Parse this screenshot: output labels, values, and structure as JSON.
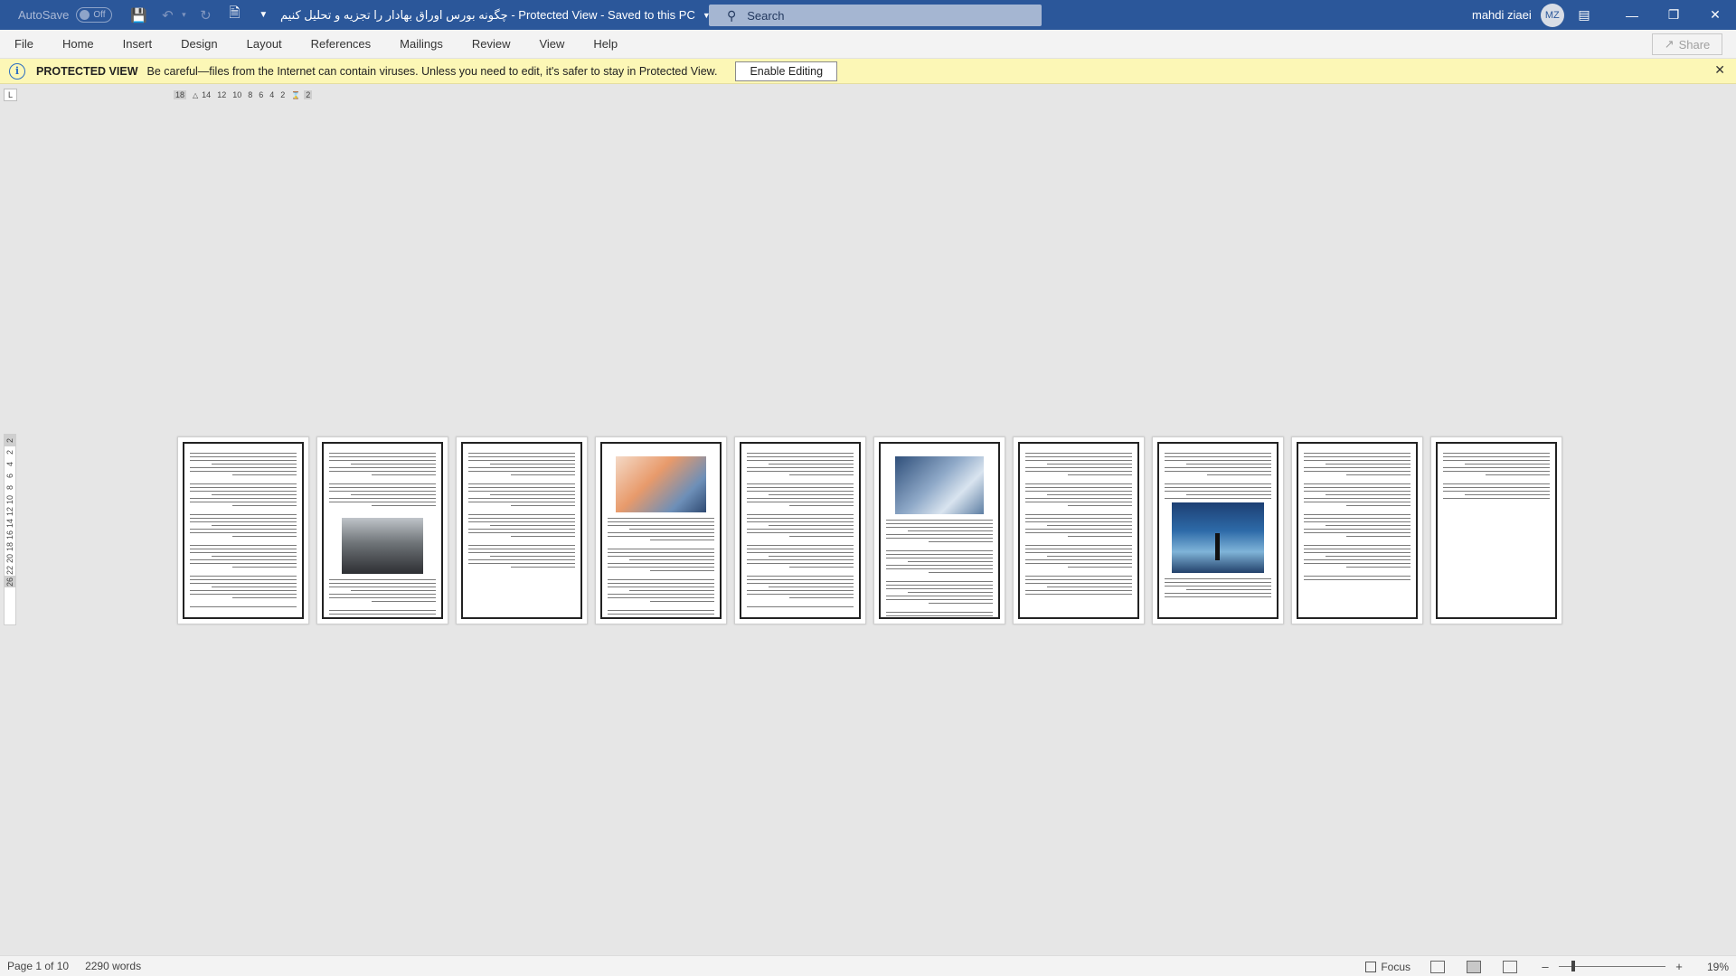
{
  "titlebar": {
    "autosave_label": "AutoSave",
    "autosave_state": "Off",
    "doc_title": "چگونه بورس اوراق بهادار را تجزیه و تحلیل کنیم  -  Protected View  -  Saved to this PC",
    "search_placeholder": "Search",
    "user_name": "mahdi ziaei",
    "user_initials": "MZ"
  },
  "ribbon": {
    "tabs": [
      "File",
      "Home",
      "Insert",
      "Design",
      "Layout",
      "References",
      "Mailings",
      "Review",
      "View",
      "Help"
    ],
    "share_label": "Share"
  },
  "message_bar": {
    "title": "PROTECTED VIEW",
    "text": "Be careful—files from the Internet can contain viruses. Unless you need to edit, it's safer to stay in Protected View.",
    "button": "Enable Editing"
  },
  "ruler": {
    "corner": "L",
    "horizontal_ticks": [
      "18",
      "14",
      "12",
      "10",
      "8",
      "6",
      "4",
      "2",
      "2"
    ],
    "vertical_ticks": [
      "2",
      "2",
      "4",
      "6",
      "8",
      "10",
      "12",
      "14",
      "16",
      "18",
      "20",
      "22",
      "26"
    ]
  },
  "statusbar": {
    "page_info": "Page 1 of 10",
    "word_count": "2290 words",
    "focus_label": "Focus",
    "zoom_percent": "19%",
    "zoom_level": 0.19
  },
  "document": {
    "page_count": 10,
    "images": [
      "chess-pieces-image",
      "orange-market-image",
      "handshake-image",
      "stock-board-image"
    ]
  }
}
